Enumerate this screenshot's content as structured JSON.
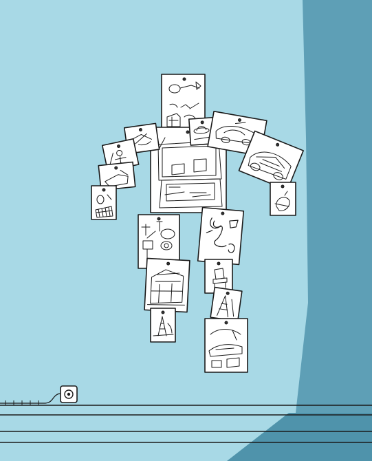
{
  "scene": {
    "colors": {
      "wall": "#a8d9e6",
      "shadow": "#5e9fb6",
      "floor": "#a8d9e6",
      "floor_shadow": "#4f93ab",
      "paper": "#ffffff",
      "ink": "#1a1a1a"
    },
    "figure": {
      "papers": [
        {
          "name": "paper-head",
          "content": "sketches-lamp-and-chair"
        },
        {
          "name": "paper-torso-room",
          "content": "interior-room-sketch"
        },
        {
          "name": "paper-shoulder-left",
          "content": "ufo-sketch"
        },
        {
          "name": "paper-upper-arm-left",
          "content": "person-sketch"
        },
        {
          "name": "paper-forearm-left",
          "content": "chair-sketch"
        },
        {
          "name": "paper-hand-left",
          "content": "chair-mesh-sketch"
        },
        {
          "name": "paper-shoulder-right",
          "content": "ufo-sketch"
        },
        {
          "name": "paper-upper-arm-right",
          "content": "car-sketch"
        },
        {
          "name": "paper-forearm-right",
          "content": "car-sketch"
        },
        {
          "name": "paper-hand-right",
          "content": "pepper-sketch"
        },
        {
          "name": "paper-thigh-left",
          "content": "lamp-sketches"
        },
        {
          "name": "paper-knee-left",
          "content": "house-sketch"
        },
        {
          "name": "paper-foot-left",
          "content": "eiffel-tower-sketch"
        },
        {
          "name": "paper-thigh-right",
          "content": "twisted-form-sketch"
        },
        {
          "name": "paper-knee-right",
          "content": "chair-sketch"
        },
        {
          "name": "paper-shin-right",
          "content": "tower-sketch"
        },
        {
          "name": "paper-foot-right",
          "content": "shoe-sketch"
        }
      ]
    },
    "outlet": {
      "icon": "power-outlet-icon"
    },
    "cable": {
      "icon": "power-cable-icon"
    }
  }
}
